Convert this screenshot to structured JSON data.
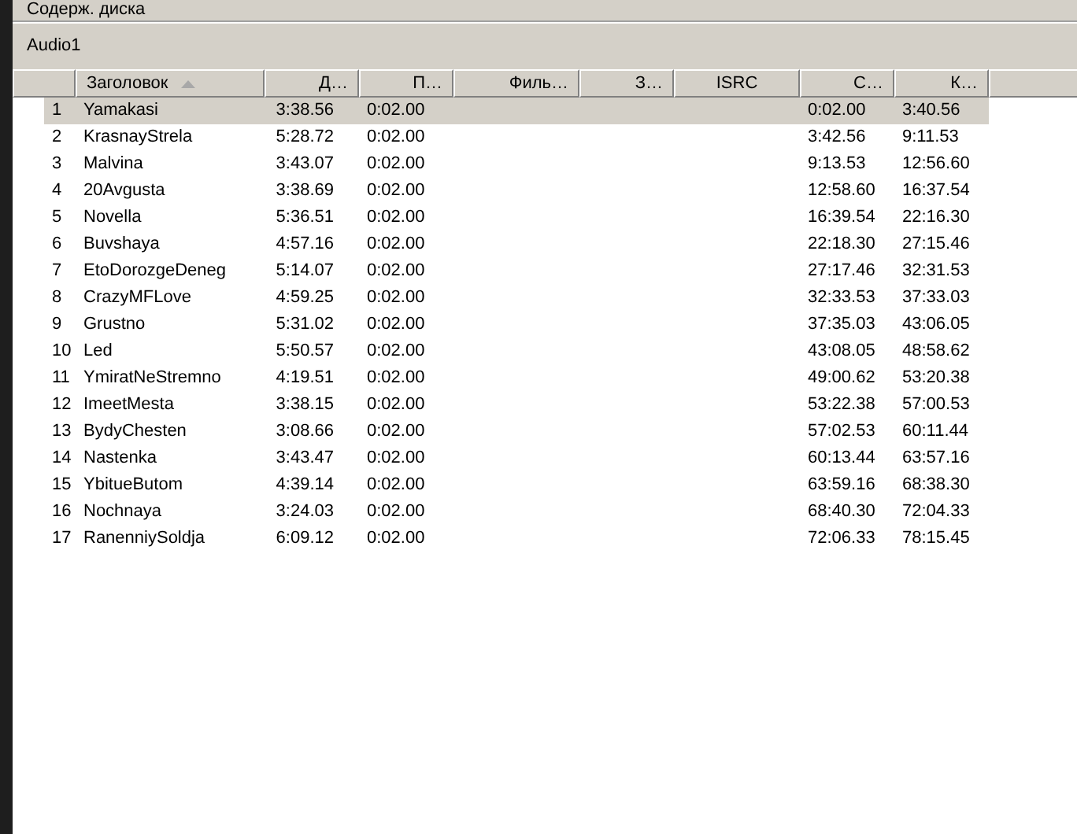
{
  "section_title": "Содерж. диска",
  "track_label": "Audio1",
  "table": {
    "columns": [
      {
        "sorted": false
      },
      {
        "label": "Заголовок",
        "sorted": true
      },
      {
        "label": "Д…",
        "sorted": false
      },
      {
        "label": "П…",
        "sorted": false
      },
      {
        "label": "Филь…",
        "sorted": false
      },
      {
        "label": "З…",
        "sorted": false
      },
      {
        "label": "ISRC",
        "sorted": false
      },
      {
        "label": "С…",
        "sorted": false
      },
      {
        "label": "К…",
        "sorted": false
      }
    ],
    "rows": [
      {
        "selected": true,
        "cells": [
          "1",
          "Yamakasi",
          "3:38.56",
          "0:02.00",
          "",
          "",
          "",
          "0:02.00",
          "3:40.56"
        ]
      },
      {
        "selected": false,
        "cells": [
          "2",
          "KrasnayStrela",
          "5:28.72",
          "0:02.00",
          "",
          "",
          "",
          "3:42.56",
          "9:11.53"
        ]
      },
      {
        "selected": false,
        "cells": [
          "3",
          "Malvina",
          "3:43.07",
          "0:02.00",
          "",
          "",
          "",
          "9:13.53",
          "12:56.60"
        ]
      },
      {
        "selected": false,
        "cells": [
          "4",
          "20Avgusta",
          "3:38.69",
          "0:02.00",
          "",
          "",
          "",
          "12:58.60",
          "16:37.54"
        ]
      },
      {
        "selected": false,
        "cells": [
          "5",
          "Novella",
          "5:36.51",
          "0:02.00",
          "",
          "",
          "",
          "16:39.54",
          "22:16.30"
        ]
      },
      {
        "selected": false,
        "cells": [
          "6",
          "Buvshaya",
          "4:57.16",
          "0:02.00",
          "",
          "",
          "",
          "22:18.30",
          "27:15.46"
        ]
      },
      {
        "selected": false,
        "cells": [
          "7",
          "EtoDorozgeDeneg",
          "5:14.07",
          "0:02.00",
          "",
          "",
          "",
          "27:17.46",
          "32:31.53"
        ]
      },
      {
        "selected": false,
        "cells": [
          "8",
          "CrazyMFLove",
          "4:59.25",
          "0:02.00",
          "",
          "",
          "",
          "32:33.53",
          "37:33.03"
        ]
      },
      {
        "selected": false,
        "cells": [
          "9",
          "Grustno",
          "5:31.02",
          "0:02.00",
          "",
          "",
          "",
          "37:35.03",
          "43:06.05"
        ]
      },
      {
        "selected": false,
        "cells": [
          "10",
          "Led",
          "5:50.57",
          "0:02.00",
          "",
          "",
          "",
          "43:08.05",
          "48:58.62"
        ]
      },
      {
        "selected": false,
        "cells": [
          "11",
          "YmiratNeStremno",
          "4:19.51",
          "0:02.00",
          "",
          "",
          "",
          "49:00.62",
          "53:20.38"
        ]
      },
      {
        "selected": false,
        "cells": [
          "12",
          "ImeetMesta",
          "3:38.15",
          "0:02.00",
          "",
          "",
          "",
          "53:22.38",
          "57:00.53"
        ]
      },
      {
        "selected": false,
        "cells": [
          "13",
          "BydyChesten",
          "3:08.66",
          "0:02.00",
          "",
          "",
          "",
          "57:02.53",
          "60:11.44"
        ]
      },
      {
        "selected": false,
        "cells": [
          "14",
          "Nastenka",
          "3:43.47",
          "0:02.00",
          "",
          "",
          "",
          "60:13.44",
          "63:57.16"
        ]
      },
      {
        "selected": false,
        "cells": [
          "15",
          "YbitueButom",
          "4:39.14",
          "0:02.00",
          "",
          "",
          "",
          "63:59.16",
          "68:38.30"
        ]
      },
      {
        "selected": false,
        "cells": [
          "16",
          "Nochnaya",
          "3:24.03",
          "0:02.00",
          "",
          "",
          "",
          "68:40.30",
          "72:04.33"
        ]
      },
      {
        "selected": false,
        "cells": [
          "17",
          "RanenniySoldja",
          "6:09.12",
          "0:02.00",
          "",
          "",
          "",
          "72:06.33",
          "78:15.45"
        ]
      }
    ]
  }
}
